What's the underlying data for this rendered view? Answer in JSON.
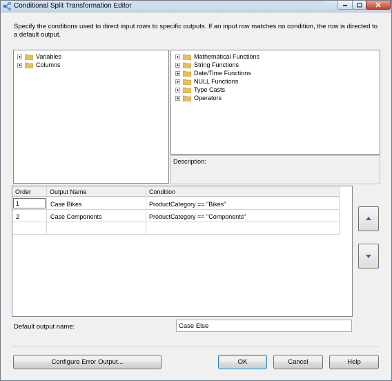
{
  "window": {
    "title": "Conditional Split Transformation Editor"
  },
  "description": "Specify the conditions used to direct input rows to specific outputs. If an input row matches no condition, the row is directed to a default output.",
  "left_tree": {
    "items": [
      {
        "label": "Variables",
        "icon": "folder-icon"
      },
      {
        "label": "Columns",
        "icon": "folder-icon"
      }
    ]
  },
  "right_tree": {
    "items": [
      {
        "label": "Mathematical Functions",
        "icon": "folder-icon"
      },
      {
        "label": "String Functions",
        "icon": "folder-icon"
      },
      {
        "label": "Date/Time Functions",
        "icon": "folder-icon"
      },
      {
        "label": "NULL Functions",
        "icon": "folder-icon"
      },
      {
        "label": "Type Casts",
        "icon": "folder-icon"
      },
      {
        "label": "Operators",
        "icon": "folder-icon"
      }
    ]
  },
  "description_box": {
    "label": "Description:"
  },
  "conditions_grid": {
    "columns": [
      "Order",
      "Output Name",
      "Condition"
    ],
    "rows": [
      {
        "order": "1",
        "output_name": "Case Bikes",
        "condition": "ProductCategory == \"Bikes\""
      },
      {
        "order": "2",
        "output_name": "Case Components",
        "condition": "ProductCategory == \"Components\""
      }
    ]
  },
  "move_buttons": {
    "up_icon": "arrow-up-icon",
    "down_icon": "arrow-down-icon"
  },
  "default_output": {
    "label": "Default output name:",
    "value": "Case Else"
  },
  "buttons": {
    "configure_error": "Configure Error Output...",
    "ok": "OK",
    "cancel": "Cancel",
    "help": "Help"
  }
}
